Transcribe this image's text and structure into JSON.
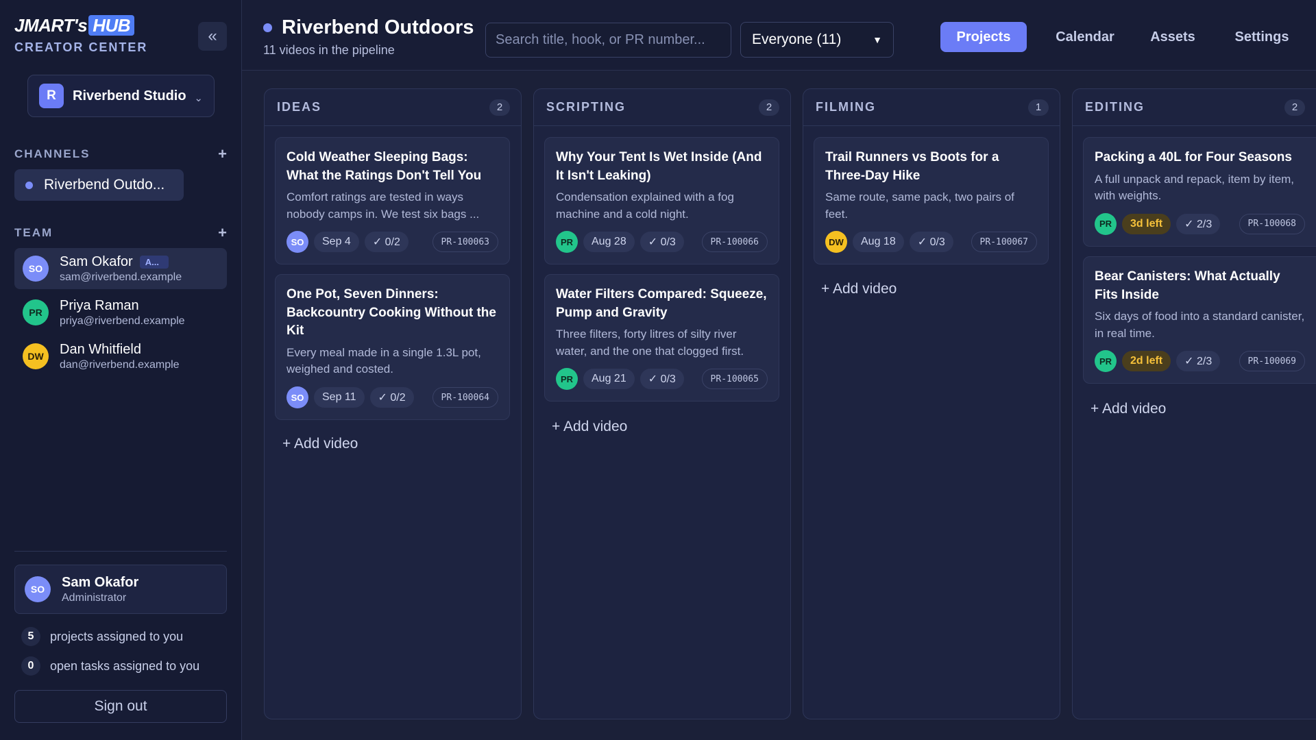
{
  "brand": {
    "logo_main": "JMART's",
    "logo_hub": "HUB",
    "subtitle": "CREATOR CENTER"
  },
  "sidebar": {
    "collapse_icon": "double-chevron-left-icon",
    "studio": {
      "initial": "R",
      "name": "Riverbend Studio"
    },
    "channels_heading": "CHANNELS",
    "channels": [
      {
        "name": "Riverbend Outdo..."
      }
    ],
    "team_heading": "TEAM",
    "team": [
      {
        "initials": "SO",
        "name": "Sam Okafor",
        "role_tag": "A...",
        "email": "sam@riverbend.example"
      },
      {
        "initials": "PR",
        "name": "Priya Raman",
        "email": "priya@riverbend.example"
      },
      {
        "initials": "DW",
        "name": "Dan Whitfield",
        "email": "dan@riverbend.example"
      }
    ],
    "current_user": {
      "initials": "SO",
      "name": "Sam Okafor",
      "role": "Administrator"
    },
    "stats": [
      {
        "count": "5",
        "label": "projects assigned to you"
      },
      {
        "count": "0",
        "label": "open tasks assigned to you"
      }
    ],
    "sign_out": "Sign out"
  },
  "header": {
    "title": "Riverbend Outdoors",
    "subtitle": "11 videos in the pipeline",
    "search_placeholder": "Search title, hook, or PR number...",
    "filter_value": "Everyone (11)",
    "tabs": [
      "Projects",
      "Calendar",
      "Assets",
      "Settings"
    ],
    "active_tab": "Projects"
  },
  "board": {
    "add_label": "+ Add video",
    "columns": [
      {
        "title": "IDEAS",
        "count": "2",
        "cards": [
          {
            "title": "Cold Weather Sleeping Bags: What the Ratings Don't Tell You",
            "desc": "Comfort ratings are tested in ways nobody camps in. We test six bags ...",
            "assignee": "SO",
            "date": "Sep 4",
            "tasks": "✓ 0/2",
            "pr": "PR-100063"
          },
          {
            "title": "One Pot, Seven Dinners: Backcountry Cooking Without the Kit",
            "desc": "Every meal made in a single 1.3L pot, weighed and costed.",
            "assignee": "SO",
            "date": "Sep 11",
            "tasks": "✓ 0/2",
            "pr": "PR-100064"
          }
        ]
      },
      {
        "title": "SCRIPTING",
        "count": "2",
        "cards": [
          {
            "title": "Why Your Tent Is Wet Inside (And It Isn't Leaking)",
            "desc": "Condensation explained with a fog machine and a cold night.",
            "assignee": "PR",
            "date": "Aug 28",
            "tasks": "✓ 0/3",
            "pr": "PR-100066"
          },
          {
            "title": "Water Filters Compared: Squeeze, Pump and Gravity",
            "desc": "Three filters, forty litres of silty river water, and the one that clogged first.",
            "assignee": "PR",
            "date": "Aug 21",
            "tasks": "✓ 0/3",
            "pr": "PR-100065"
          }
        ]
      },
      {
        "title": "FILMING",
        "count": "1",
        "cards": [
          {
            "title": "Trail Runners vs Boots for a Three-Day Hike",
            "desc": "Same route, same pack, two pairs of feet.",
            "assignee": "DW",
            "date": "Aug 18",
            "tasks": "✓ 0/3",
            "pr": "PR-100067"
          }
        ]
      },
      {
        "title": "EDITING",
        "count": "2",
        "cards": [
          {
            "title": "Packing a 40L for Four Seasons",
            "desc": "A full unpack and repack, item by item, with weights.",
            "assignee": "PR",
            "due": "3d left",
            "tasks": "✓ 2/3",
            "pr": "PR-100068"
          },
          {
            "title": "Bear Canisters: What Actually Fits Inside",
            "desc": "Six days of food into a standard canister, in real time.",
            "assignee": "PR",
            "due": "2d left",
            "tasks": "✓ 2/3",
            "pr": "PR-100069"
          }
        ]
      }
    ]
  },
  "colors": {
    "accent": "#6b7cf6",
    "so": "#7b8df8",
    "pr": "#22c58b",
    "dw": "#f5c021",
    "warn": "#f6c13a"
  }
}
